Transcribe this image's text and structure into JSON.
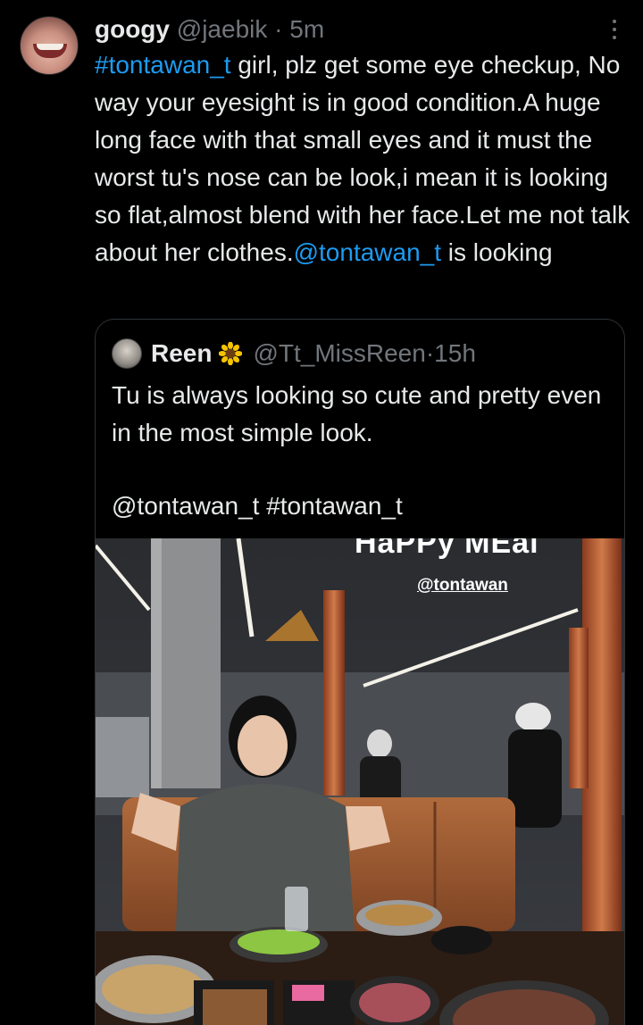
{
  "tweet": {
    "author": {
      "display_name": "googy",
      "handle": "@jaebik",
      "separator": "·",
      "time": "5m"
    },
    "text": {
      "hashtag": "#tontawan_t",
      "part1": " girl, plz get some eye checkup, No way your eyesight is in good condition.A huge long face with that small eyes and it must the worst tu's nose can be look,i mean it is looking so flat,almost blend with her face.Let me not talk about her clothes.",
      "mention": "@tontawan_t",
      "part2": " is looking"
    }
  },
  "quoted_tweet": {
    "author": {
      "display_name": "Reen",
      "badge_icon": "sunflower-icon",
      "handle": "@Tt_MissReen",
      "separator": "·",
      "time": "15h"
    },
    "text": "Tu is always looking so cute and pretty even in the most simple look.",
    "tags": "@tontawan_t  #tontawan_t",
    "media": {
      "overlay_title": "HaPPy MEal",
      "overlay_handle": "@tontawan"
    }
  },
  "colors": {
    "background": "#000000",
    "text": "#e7e9ea",
    "muted": "#71767b",
    "link": "#1d9bf0",
    "border": "#2f3336"
  }
}
